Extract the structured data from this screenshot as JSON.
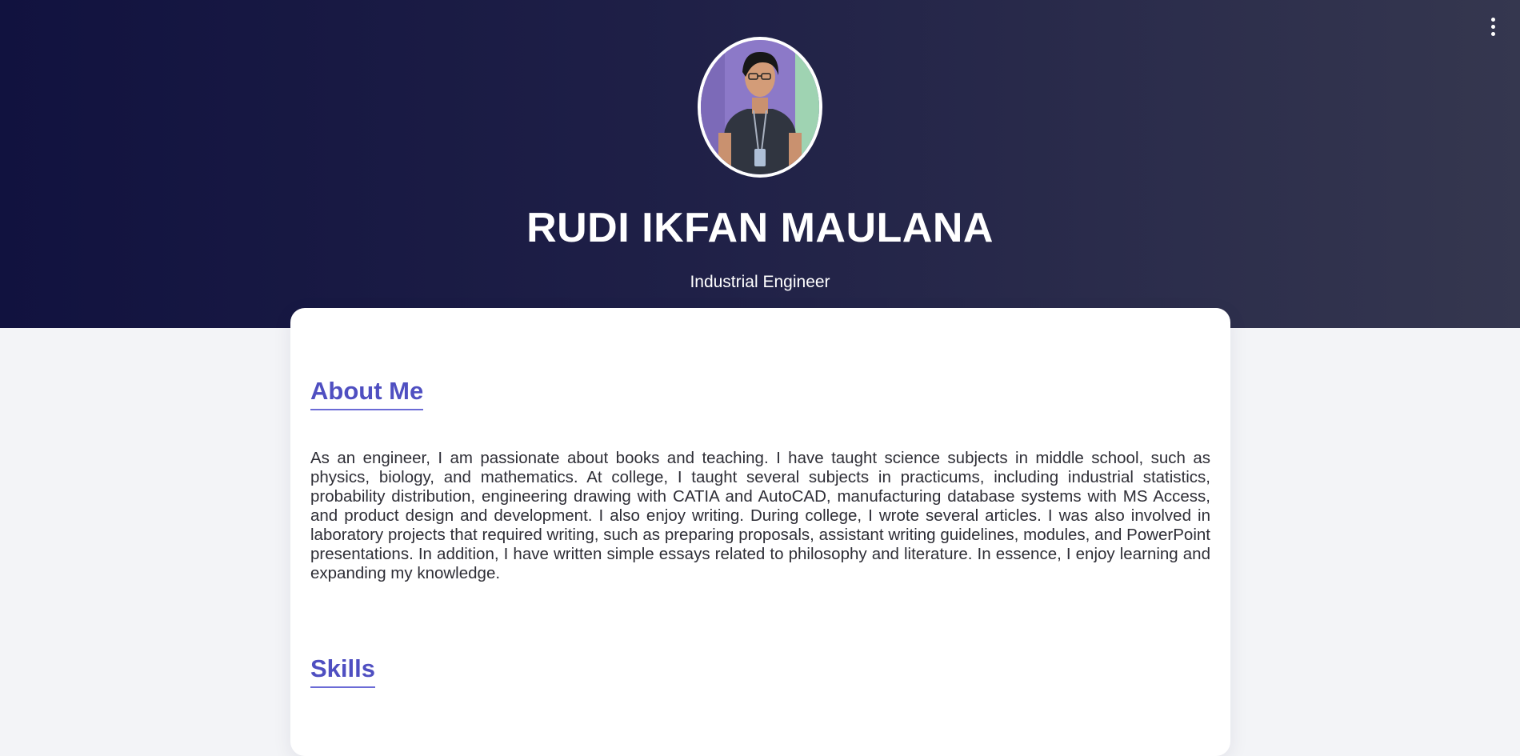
{
  "header": {
    "name": "RUDI IKFAN MAULANA",
    "role": "Industrial Engineer",
    "menu_icon": "kebab-menu-icon"
  },
  "about": {
    "title": "About Me",
    "text": "As an engineer, I am passionate about books and teaching. I have taught science subjects in middle school, such as physics, biology, and mathematics. At college, I taught several subjects in practicums, including industrial statistics, probability distribution, engineering drawing with CATIA and AutoCAD, manufacturing database systems with MS Access, and product design and development. I also enjoy writing. During college, I wrote several articles. I was also involved in laboratory projects that required writing, such as preparing proposals, assistant writing guidelines, modules, and PowerPoint presentations. In addition, I have written simple essays related to philosophy and literature. In essence, I enjoy learning and expanding my knowledge."
  },
  "skills": {
    "title": "Skills"
  },
  "colors": {
    "hero_start": "#11123f",
    "hero_end": "#35374f",
    "accent": "#4f4fc1",
    "page_background": "#f3f4f7",
    "text": "#2e2e36"
  }
}
